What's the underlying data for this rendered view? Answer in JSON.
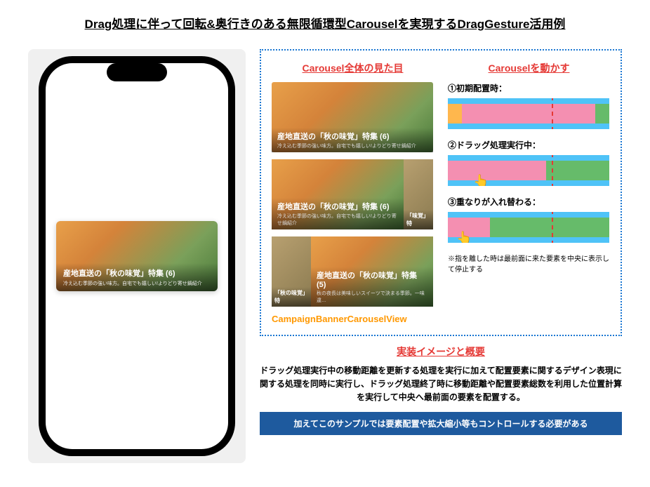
{
  "title": "Drag処理に伴って回転&奥行きのある無限循環型Carouselを実現するDragGesture活用例",
  "phone_banner": {
    "title": "産地直送の「秋の味覚」特集 (6)",
    "subtitle": "冷え込む季節の強い味方。自宅でも嬉しい!よりどり寄せ鍋紹介"
  },
  "appearance": {
    "heading": "Carousel全体の見た目",
    "img1_title": "産地直送の「秋の味覚」特集 (6)",
    "img1_sub": "冷え込む季節の強い味方。自宅でも嬉しい!よりどり寄せ鍋紹介",
    "img2_title": "産地直送の「秋の味覚」特集 (6)",
    "img2_sub": "冷え込む季節の強い味方。自宅でも嬉しい!よりどり寄せ鍋紹介",
    "img2_side": "「味覚」特",
    "img3_left_title": "「秋の味覚」特",
    "img3_center_title": "産地直送の「秋の味覚」特集 (5)",
    "img3_center_sub": "秋の夜長は美味しいスイーツで決まる季節。一味違…",
    "component_name": "CampaignBannerCarouselView"
  },
  "states": {
    "heading": "Carouselを動かす",
    "state1": "①初期配置時：",
    "state2": "②ドラッグ処理実行中：",
    "state3": "③重なりが入れ替わる：",
    "footnote": "※指を離した時は最前面に来た要素を中央に表示して停止する"
  },
  "impl": {
    "heading": "実装イメージと概要",
    "body": "ドラッグ処理実行中の移動距離を更新する処理を実行に加えて配置要素に関するデザイン表現に関する処理を同時に実行し、ドラッグ処理終了時に移動距離や配置要素総数を利用した位置計算を実行して中央へ最前面の要素を配置する。",
    "note": "加えてこのサンプルでは要素配置や拡大縮小等もコントロールする必要がある"
  }
}
